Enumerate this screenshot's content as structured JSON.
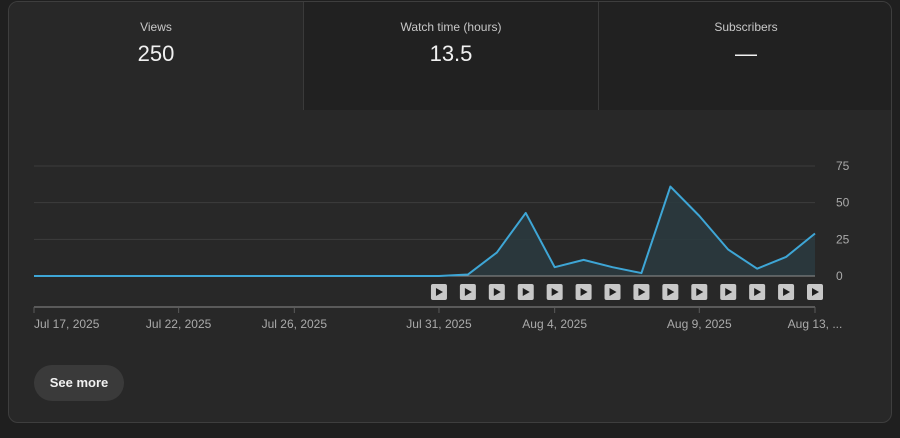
{
  "tabs": [
    {
      "label": "Views",
      "value": "250"
    },
    {
      "label": "Watch time (hours)",
      "value": "13.5"
    },
    {
      "label": "Subscribers",
      "value": "—"
    }
  ],
  "see_more_label": "See more",
  "colors": {
    "line": "#3ea6d6",
    "area": "#2a3a40",
    "grid": "#3d3d3d",
    "axis_text": "#aaaaaa",
    "tab_bg": "#212121",
    "card_bg": "#282828"
  },
  "icons": {
    "video_marker": "play-icon"
  },
  "chart_data": {
    "type": "area",
    "x": [
      "Jul 17, 2025",
      "Jul 18, 2025",
      "Jul 19, 2025",
      "Jul 20, 2025",
      "Jul 21, 2025",
      "Jul 22, 2025",
      "Jul 23, 2025",
      "Jul 24, 2025",
      "Jul 25, 2025",
      "Jul 26, 2025",
      "Jul 27, 2025",
      "Jul 28, 2025",
      "Jul 29, 2025",
      "Jul 30, 2025",
      "Jul 31, 2025",
      "Aug 1, 2025",
      "Aug 2, 2025",
      "Aug 3, 2025",
      "Aug 4, 2025",
      "Aug 5, 2025",
      "Aug 6, 2025",
      "Aug 7, 2025",
      "Aug 8, 2025",
      "Aug 9, 2025",
      "Aug 10, 2025",
      "Aug 11, 2025",
      "Aug 12, 2025",
      "Aug 13, 2025"
    ],
    "series": [
      {
        "values": [
          0,
          0,
          0,
          0,
          0,
          0,
          0,
          0,
          0,
          0,
          0,
          0,
          0,
          0,
          0,
          1,
          16,
          43,
          6,
          11,
          6,
          2,
          61,
          41,
          18,
          5,
          13,
          29
        ]
      }
    ],
    "x_tick_labels": [
      "Jul 17, 2025",
      "Jul 22, 2025",
      "Jul 26, 2025",
      "Jul 31, 2025",
      "Aug 4, 2025",
      "Aug 9, 2025",
      "Aug 13, ..."
    ],
    "x_tick_index": [
      0,
      5,
      9,
      14,
      18,
      23,
      27
    ],
    "y_ticks": [
      "0",
      "25",
      "50",
      "75"
    ],
    "ylim": [
      0,
      75
    ],
    "y_axis_side": "right",
    "grid": true,
    "video_markers_index": [
      14,
      15,
      16,
      17,
      18,
      19,
      20,
      21,
      22,
      23,
      24,
      25,
      26,
      27
    ]
  }
}
